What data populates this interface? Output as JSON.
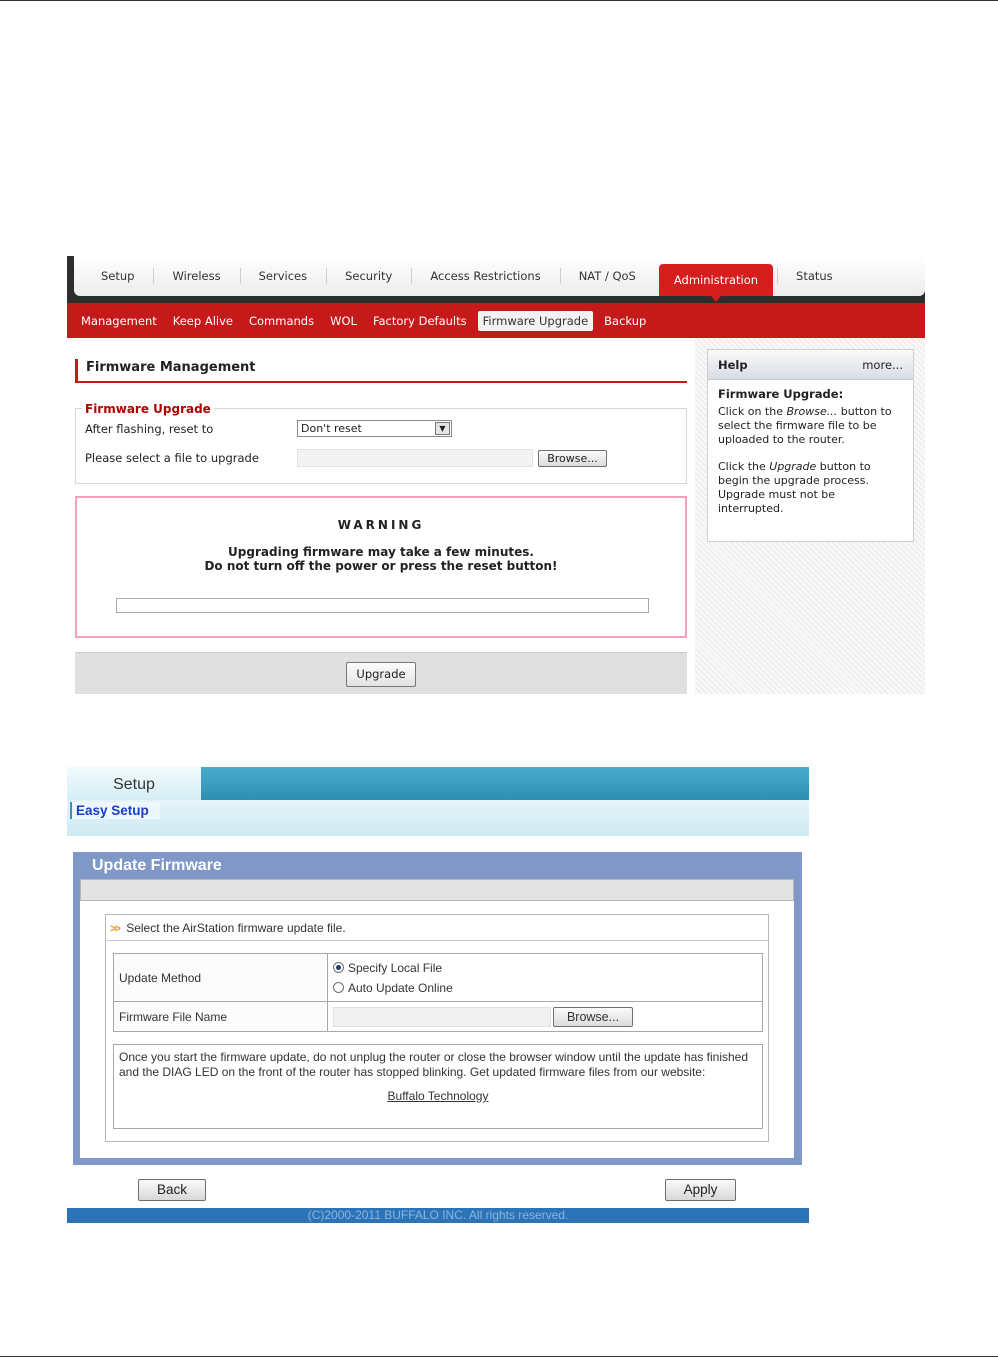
{
  "ddwrt": {
    "tabs": [
      "Setup",
      "Wireless",
      "Services",
      "Security",
      "Access Restrictions",
      "NAT / QoS",
      "Administration",
      "Status"
    ],
    "active_tab": "Administration",
    "subtabs": [
      "Management",
      "Keep Alive",
      "Commands",
      "WOL",
      "Factory Defaults",
      "Firmware Upgrade",
      "Backup"
    ],
    "active_subtab": "Firmware Upgrade",
    "section_title": "Firmware Management",
    "fieldset_legend": "Firmware Upgrade",
    "reset_label": "After flashing, reset to",
    "reset_value": "Don't reset",
    "file_label": "Please select a file to upgrade",
    "browse_label": "Browse...",
    "warning_title": "WARNING",
    "warning_line1": "Upgrading firmware may take a few minutes.",
    "warning_line2": "Do not turn off the power or press the reset button!",
    "upgrade_label": "Upgrade",
    "help": {
      "title": "Help",
      "more": "more...",
      "heading": "Firmware Upgrade:",
      "p1_a": "Click on the ",
      "p1_em": "Browse...",
      "p1_b": " button to select the firmware file to be uploaded to the router.",
      "p2_a": "Click the ",
      "p2_em": "Upgrade",
      "p2_b": " button to begin the upgrade process. Upgrade must not be interrupted."
    },
    "colors": {
      "brand_red": "#c41a1a",
      "active_tab": "#d71e1e",
      "warning_border": "#f2a2b8"
    }
  },
  "buffalo": {
    "tab": "Setup",
    "subtab": "Easy Setup",
    "panel_title": "Update Firmware",
    "box_heading": "Select the AirStation firmware update file.",
    "update_method_label": "Update Method",
    "options": [
      "Specify Local File",
      "Auto Update Online"
    ],
    "selected_option": "Specify Local File",
    "file_name_label": "Firmware File Name",
    "browse_label": "Browse...",
    "note": "Once you start the firmware update, do not unplug the router or close the browser window until the update has finished and the DIAG LED on the front of the router has stopped blinking. Get updated firmware files from our website:",
    "link": "Buffalo Technology",
    "back_label": "Back",
    "apply_label": "Apply",
    "footer": "(C)2000-2011 BUFFALO INC. All rights reserved.",
    "colors": {
      "header_blue": "#2e8fb3",
      "panel_blue": "#7f98c8",
      "footer_blue": "#2b74b8",
      "link_blue": "#1540c2"
    }
  }
}
